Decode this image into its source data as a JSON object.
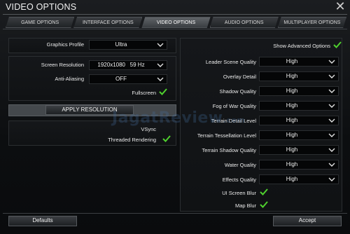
{
  "window": {
    "title": "VIDEO OPTIONS",
    "close_glyph": "✕"
  },
  "tabs": [
    {
      "label": "GAME OPTIONS",
      "active": false
    },
    {
      "label": "INTERFACE OPTIONS",
      "active": false
    },
    {
      "label": "VIDEO OPTIONS",
      "active": true
    },
    {
      "label": "AUDIO OPTIONS",
      "active": false
    },
    {
      "label": "MULTIPLAYER OPTIONS",
      "active": false
    }
  ],
  "left": {
    "graphics_profile": {
      "label": "Graphics Profile",
      "value": "Ultra"
    },
    "screen_resolution": {
      "label": "Screen Resolution",
      "value": "1920x1080   59 Hz"
    },
    "anti_aliasing": {
      "label": "Anti-Aliasing",
      "value": "OFF"
    },
    "fullscreen": {
      "label": "Fullscreen",
      "checked": true
    },
    "apply_button": "APPLY RESOLUTION",
    "vsync": {
      "label": "VSync",
      "checked": false
    },
    "threaded_rendering": {
      "label": "Threaded Rendering",
      "checked": true
    }
  },
  "right": {
    "show_advanced": {
      "label": "Show Advanced Options",
      "checked": true
    },
    "settings": [
      {
        "label": "Leader Scene Quality",
        "value": "High"
      },
      {
        "label": "Overlay Detail",
        "value": "High"
      },
      {
        "label": "Shadow Quality",
        "value": "High"
      },
      {
        "label": "Fog of War Quality",
        "value": "High"
      },
      {
        "label": "Terrain Detail Level",
        "value": "High"
      },
      {
        "label": "Terrain Tessellation Level",
        "value": "High"
      },
      {
        "label": "Terrain Shadow Quality",
        "value": "High"
      },
      {
        "label": "Water Quality",
        "value": "High"
      },
      {
        "label": "Effects Quality",
        "value": "High"
      }
    ],
    "ui_screen_blur": {
      "label": "UI Screen Blur",
      "checked": true
    },
    "map_blur": {
      "label": "Map Blur",
      "checked": true
    }
  },
  "footer": {
    "defaults_button": "Defaults",
    "accept_button": "Accept"
  },
  "watermark": {
    "main": "JagatReview",
    "suffix": ".com"
  },
  "colors": {
    "check_green": "#4fd12e",
    "active_tab": "#505458"
  }
}
